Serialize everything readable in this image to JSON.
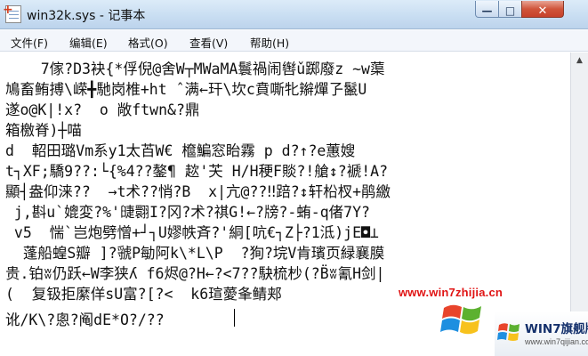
{
  "window": {
    "title": "win32k.sys - 记事本"
  },
  "controls": {
    "minimize": "—",
    "maximize": "□",
    "close": "✕"
  },
  "menu": [
    {
      "label": "文件(F)"
    },
    {
      "label": "编辑(E)"
    },
    {
      "label": "格式(O)"
    },
    {
      "label": "查看(V)"
    },
    {
      "label": "帮助(H)"
    }
  ],
  "editor": {
    "lines": [
      "    7傢?D3袂{*俘倪@舍W┬MWaMA鬟禍闹辔ǔ踯廢z ~w蕖",
      "鳩畜鲔搏\\嵘╋馳岗椎+ht ˆ满←玕\\坎c賁嘶牝辮燀孒鬣U",
      "遂o@K|!x?  o 敞ftwn&?鼎",
      "箱檄脊)┼喵",
      "d  軺田璐Vm系y1太苩W€ 檶鯿窓眙霧 p d?↑?e蕙嫂",
      "t┐XF;驕9??:└{%4??鏊¶ 趑'芖 H/H稉F賧?!艙↕?褫!A?",
      "顯┤盎仰涞??  →t术??悄?B  x|亢@??‼踣?↕轩柗杈+鹃繳",
      " j,斟u`媲変?%'䑖翾I?冈?术?祺G!←?牓?-蛕-q偖7Y?",
      " v5  惴`岂炮劈憎+┘┐U嫪帙斉?'絧[吭€┐Z├?1泜)jE◘⊥",
      "  蓬船蝗S瓣 ]?虢P勄阿k\\*L\\P  ?狥?垸V肯璸页緑襄膜",
      "贵.铂ʬ仍跃←W李狭ʎ f6烬@?H←?<7??駃梳杪(?B̈ʬ氰H剑|",
      "(  复钑拒縻佯sU富?[?<  k6瑄薆夆鲭郏",
      "讹/K\\?悤?阄dE*O?/??"
    ]
  },
  "watermark": {
    "url": "www.win7zhijia.cn",
    "badge_title": "WIN7旗舰版",
    "badge_sub": "www.win7qijian.com"
  },
  "colors": {
    "watermark_red": "#e01414",
    "close_red": "#c7412a"
  }
}
